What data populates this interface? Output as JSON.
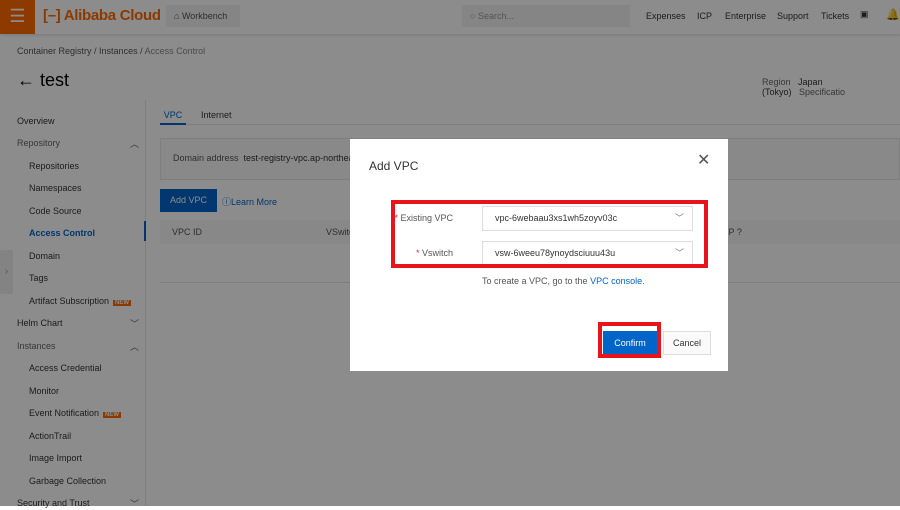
{
  "header": {
    "brand": "Alibaba Cloud",
    "workbench": "Workbench",
    "search_placeholder": "Search...",
    "nav": [
      "Expenses",
      "ICP",
      "Enterprise",
      "Support",
      "Tickets"
    ],
    "accent": "#ff6a00"
  },
  "breadcrumb": [
    "Container Registry",
    "Instances",
    "Access Control"
  ],
  "page": {
    "title": "test",
    "region_label": "Region",
    "region_value": "Japan (Tokyo)",
    "spec_label": "Specificatio"
  },
  "sidebar": {
    "items": [
      {
        "label": "Overview"
      },
      {
        "label": "Repository",
        "group": true
      },
      {
        "label": "Repositories"
      },
      {
        "label": "Namespaces"
      },
      {
        "label": "Code Source"
      },
      {
        "label": "Access Control",
        "active": true
      },
      {
        "label": "Domain"
      },
      {
        "label": "Tags"
      },
      {
        "label": "Artifact Subscription",
        "badge": "NEW"
      },
      {
        "label": "Helm Chart"
      },
      {
        "label": "Instances",
        "group": true
      },
      {
        "label": "Access Credential"
      },
      {
        "label": "Monitor"
      },
      {
        "label": "Event Notification",
        "badge": "NEW"
      },
      {
        "label": "ActionTrail"
      },
      {
        "label": "Image Import"
      },
      {
        "label": "Garbage Collection"
      },
      {
        "label": "Security and Trust"
      }
    ]
  },
  "main": {
    "tabs": [
      "VPC",
      "Internet"
    ],
    "domain_label": "Domain address",
    "domain_value": "test-registry-vpc.ap-northeast-",
    "add_vpc": "Add VPC",
    "learn_more": "Learn More",
    "columns": [
      "VPC ID",
      "VSwitch",
      "IP"
    ]
  },
  "modal": {
    "title": "Add VPC",
    "vpc_label": "Existing VPC",
    "vpc_value": "vpc-6webaau3xs1wh5zoyv03c",
    "vswitch_label": "Vswitch",
    "vswitch_value": "vsw-6weeu78ynoydsciuuu43u",
    "hint": "To create a VPC, go to the ",
    "hint_link": "VPC console",
    "hint_end": ".",
    "confirm": "Confirm",
    "cancel": "Cancel",
    "highlight_color": "#e8141c"
  }
}
